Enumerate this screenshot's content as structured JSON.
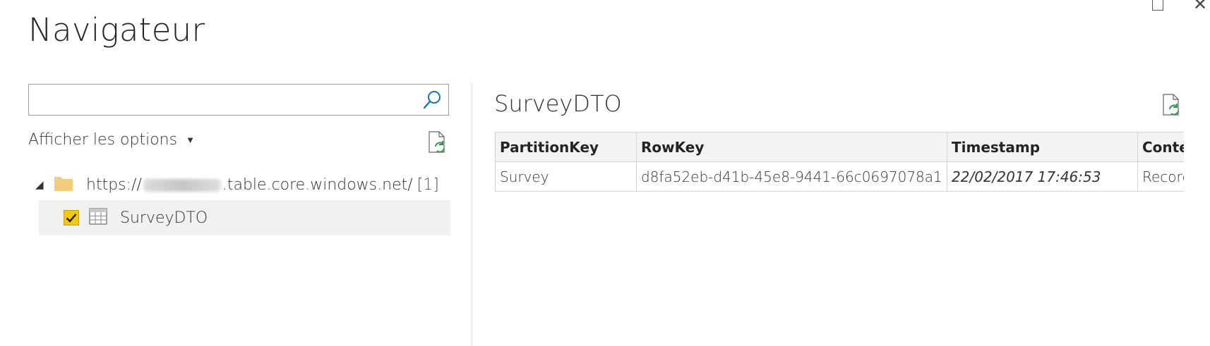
{
  "window": {
    "title": "Navigateur"
  },
  "search": {
    "value": "",
    "placeholder": ""
  },
  "options": {
    "label": "Afficher les options"
  },
  "tree": {
    "root": {
      "url_prefix": "https://",
      "url_suffix": ".table.core.windows.net/",
      "count": "[1]"
    },
    "items": [
      {
        "label": "SurveyDTO",
        "checked": true
      }
    ]
  },
  "preview": {
    "title": "SurveyDTO",
    "columns": [
      "PartitionKey",
      "RowKey",
      "Timestamp",
      "Conter"
    ],
    "rows": [
      [
        "Survey",
        "d8fa52eb-d41b-45e8-9441-66c0697078a1",
        "22/02/2017 17:46:53",
        "Record"
      ]
    ]
  },
  "colors": {
    "accent": "#f2c811",
    "refresh_green": "#2e9a4a",
    "search_blue": "#1a73b5",
    "folder": "#f4cd7a",
    "selected_bg": "#f1f1f1"
  },
  "icons": {
    "search": "search-icon",
    "refresh": "refresh-icon",
    "folder": "folder-icon",
    "table": "table-icon",
    "expander": "collapse-triangle-icon",
    "caret": "chevron-down-icon"
  }
}
